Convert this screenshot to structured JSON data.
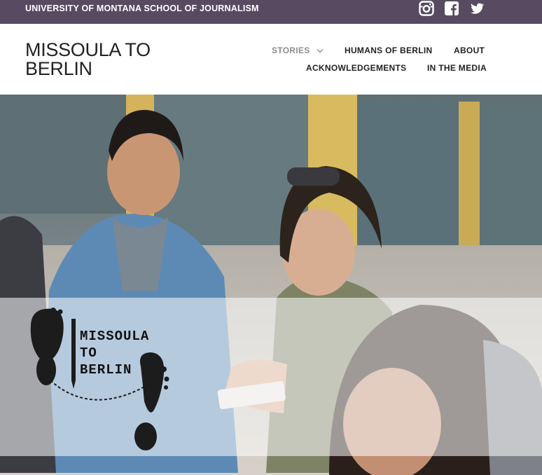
{
  "topbar": {
    "school_name": "UNIVERSITY OF MONTANA SCHOOL OF JOURNALISM",
    "social_icons": [
      "instagram-icon",
      "facebook-icon",
      "twitter-icon"
    ]
  },
  "header": {
    "site_title_line1": "MISSOULA TO",
    "site_title_line2": "BERLIN"
  },
  "nav": {
    "items": [
      {
        "label": "STORIES",
        "has_dropdown": true,
        "active": false
      },
      {
        "label": "HUMANS OF BERLIN"
      },
      {
        "label": "ABOUT"
      },
      {
        "label": "ACKNOWLEDGEMENTS"
      },
      {
        "label": "IN THE MEDIA"
      }
    ]
  },
  "hero": {
    "logo_text": {
      "line1": "MISSOULA",
      "line2": "TO",
      "line3": "BERLIN"
    }
  },
  "colors": {
    "topbar": "#574a61",
    "nav_text": "#222222",
    "nav_dim": "#8e8e8e"
  }
}
